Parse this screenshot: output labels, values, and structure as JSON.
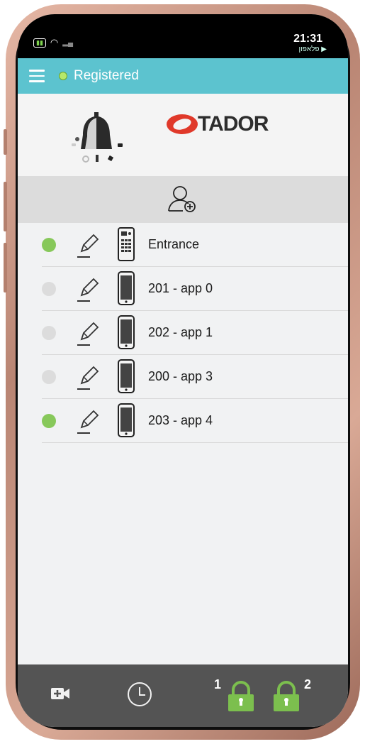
{
  "status_bar": {
    "time": "21:31",
    "carrier": "פלאפון ▶"
  },
  "header": {
    "status_label": "Registered",
    "status_color": "#b6e86a"
  },
  "brand": {
    "name": "TADOR"
  },
  "colors": {
    "accent": "#5cc3cf",
    "online": "#87c85a",
    "offline": "#dcdcdc",
    "lock": "#7cbf4e"
  },
  "devices": [
    {
      "name": "Entrance",
      "status": "online",
      "device_icon": "intercom-panel-icon"
    },
    {
      "name": "201 - app 0",
      "status": "offline",
      "device_icon": "phone-icon"
    },
    {
      "name": "202 - app 1",
      "status": "offline",
      "device_icon": "phone-icon"
    },
    {
      "name": "200 - app 3",
      "status": "offline",
      "device_icon": "phone-icon"
    },
    {
      "name": "203 - app 4",
      "status": "online",
      "device_icon": "phone-icon"
    }
  ],
  "bottom_nav": {
    "video_icon": "video-camera-icon",
    "history_icon": "clock-icon",
    "lock1_label": "1",
    "lock2_label": "2"
  }
}
